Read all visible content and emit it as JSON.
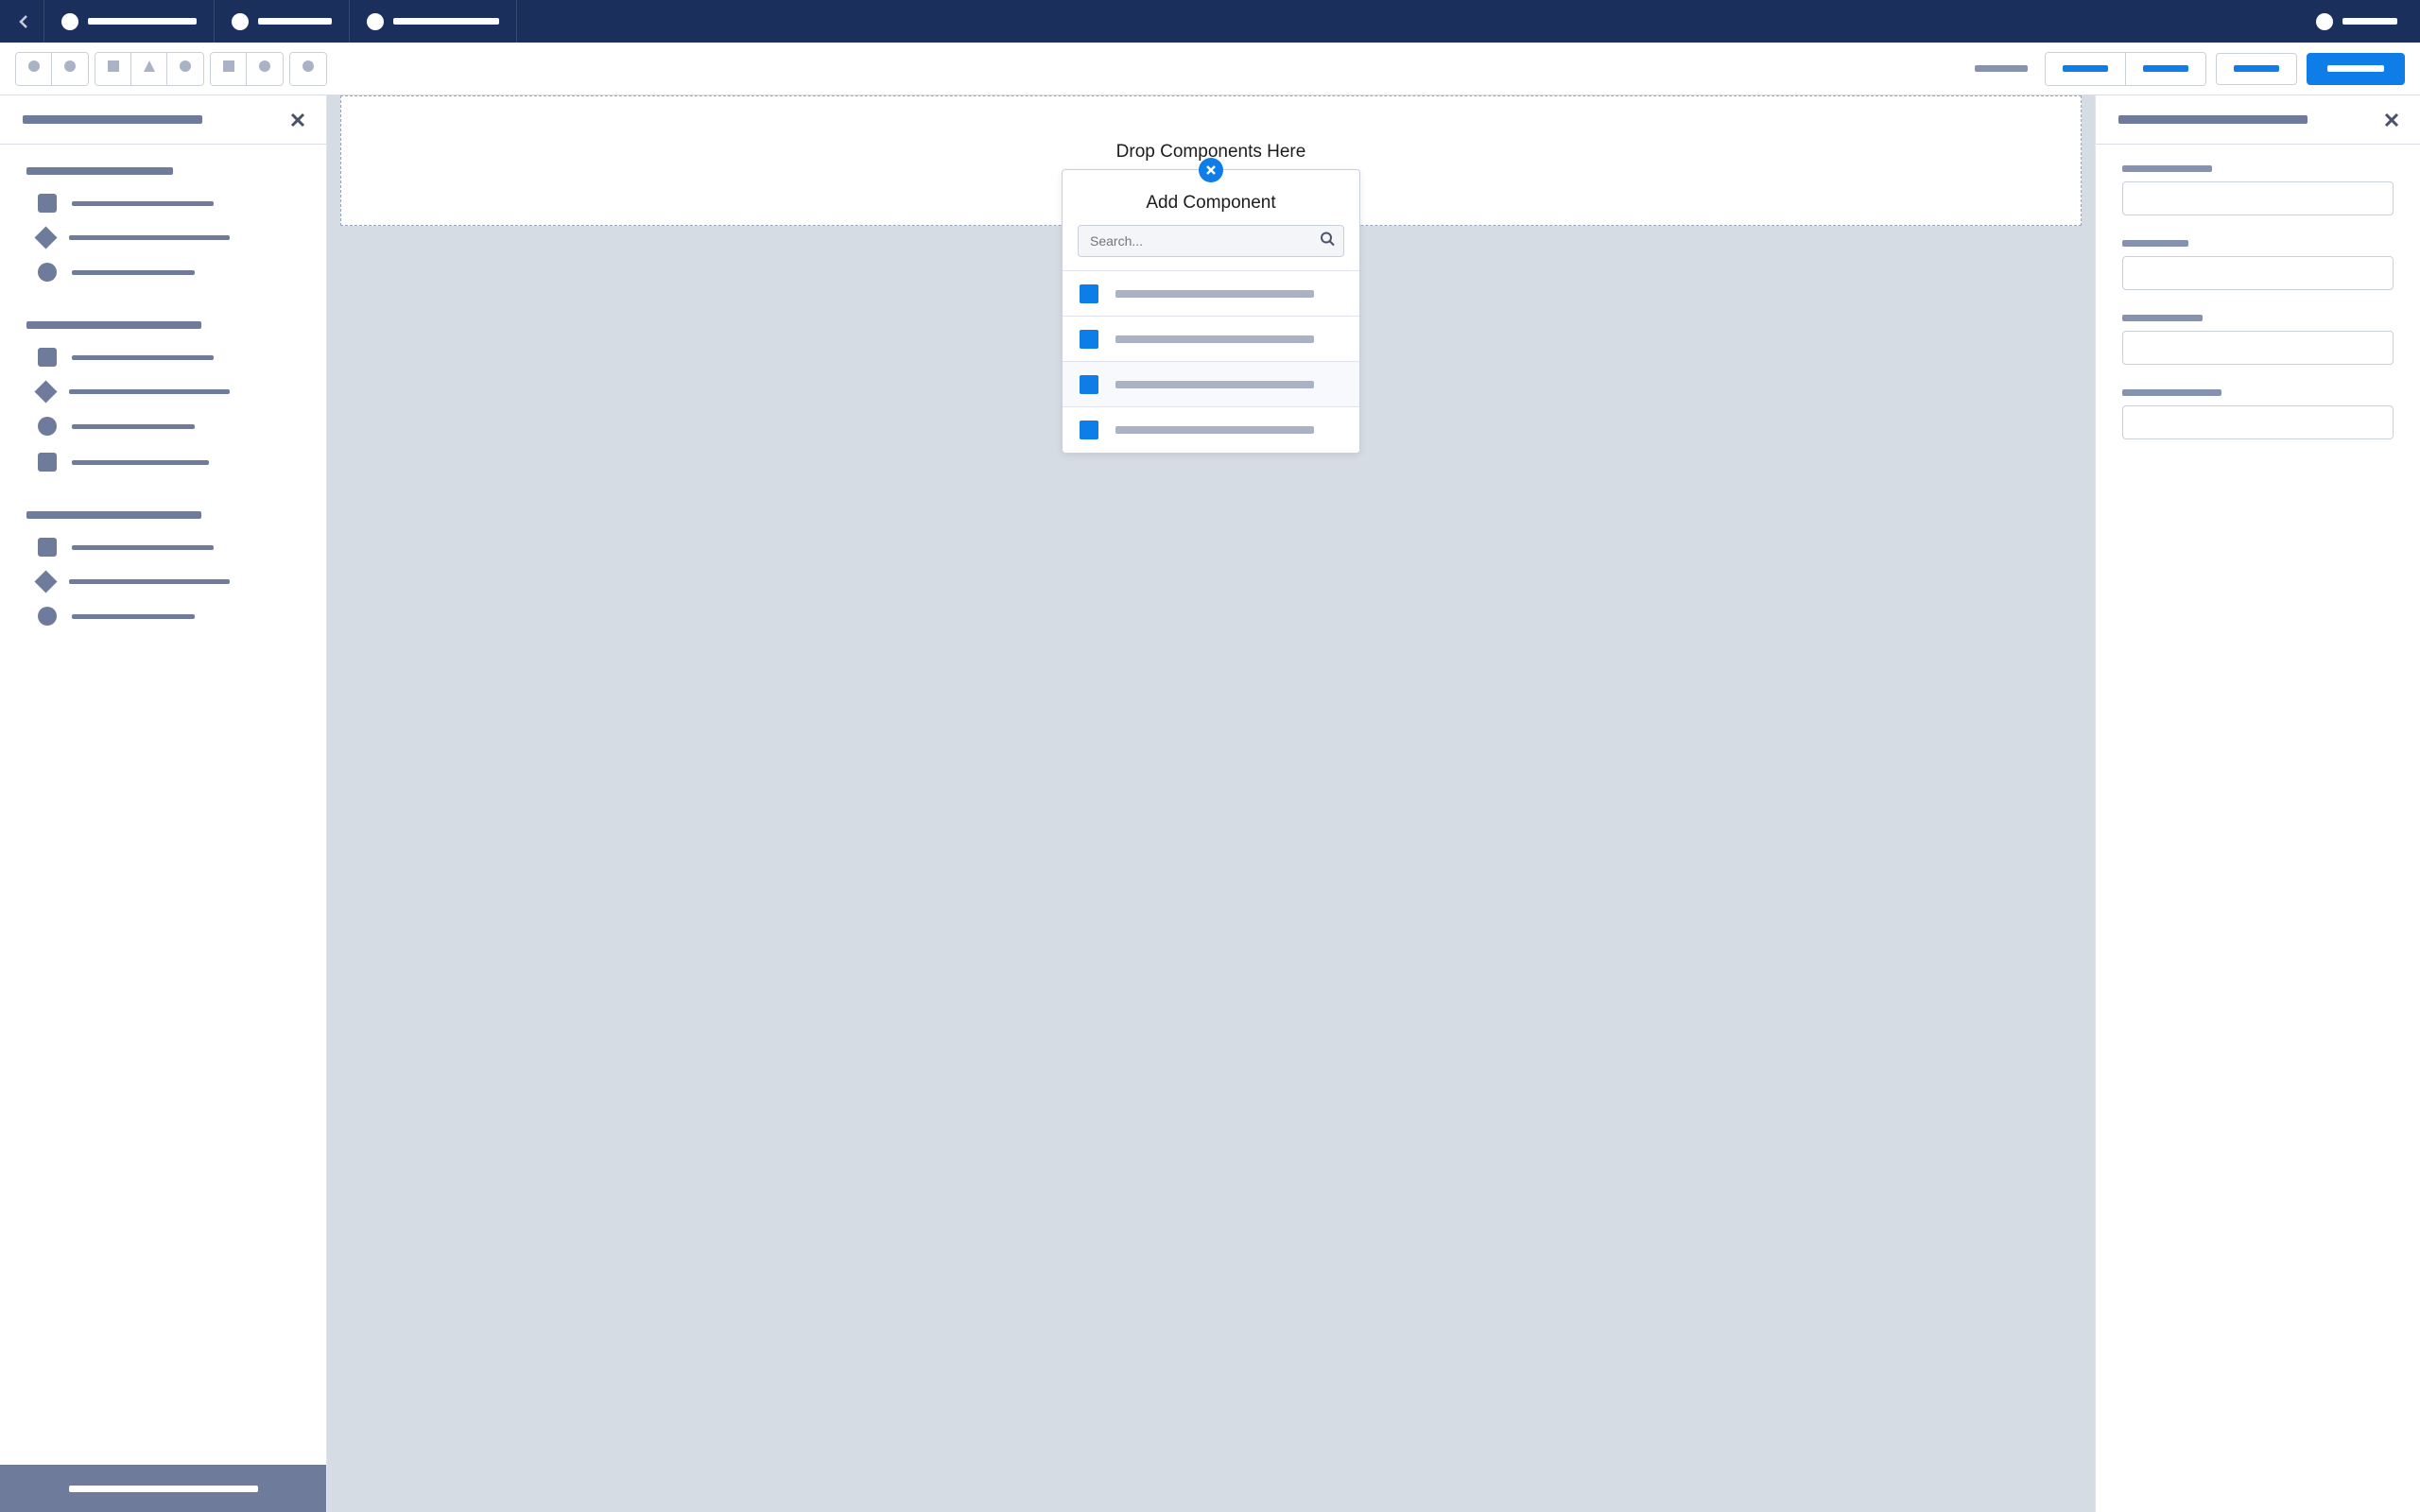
{
  "topnav": {
    "tabs": [
      {
        "lineWidth": 115
      },
      {
        "lineWidth": 78
      },
      {
        "lineWidth": 112
      }
    ],
    "right": {
      "lineWidth": 58
    }
  },
  "toolbar": {
    "groups": [
      [
        "circle",
        "circle"
      ],
      [
        "square",
        "triangle",
        "circle"
      ],
      [
        "square",
        "circle"
      ],
      [
        "circle"
      ]
    ]
  },
  "leftPanel": {
    "sections": [
      {
        "heading": "w1",
        "items": [
          {
            "shape": "square",
            "w": 150
          },
          {
            "shape": "diamond",
            "w": 170
          },
          {
            "shape": "circle",
            "w": 130
          }
        ]
      },
      {
        "heading": "w2",
        "items": [
          {
            "shape": "square",
            "w": 150
          },
          {
            "shape": "diamond",
            "w": 170
          },
          {
            "shape": "circle",
            "w": 130
          },
          {
            "shape": "square",
            "w": 145
          }
        ]
      },
      {
        "heading": "w3",
        "items": [
          {
            "shape": "square",
            "w": 150
          },
          {
            "shape": "diamond",
            "w": 170
          },
          {
            "shape": "circle",
            "w": 130
          }
        ]
      }
    ]
  },
  "canvas": {
    "dropzone_text": "Drop Components Here"
  },
  "popover": {
    "title": "Add Component",
    "search_placeholder": "Search...",
    "rows": [
      {
        "hover": false
      },
      {
        "hover": false
      },
      {
        "hover": true
      },
      {
        "hover": false
      }
    ]
  },
  "rightPanel": {
    "fields": [
      "w1",
      "w2",
      "w3",
      "w4"
    ]
  }
}
